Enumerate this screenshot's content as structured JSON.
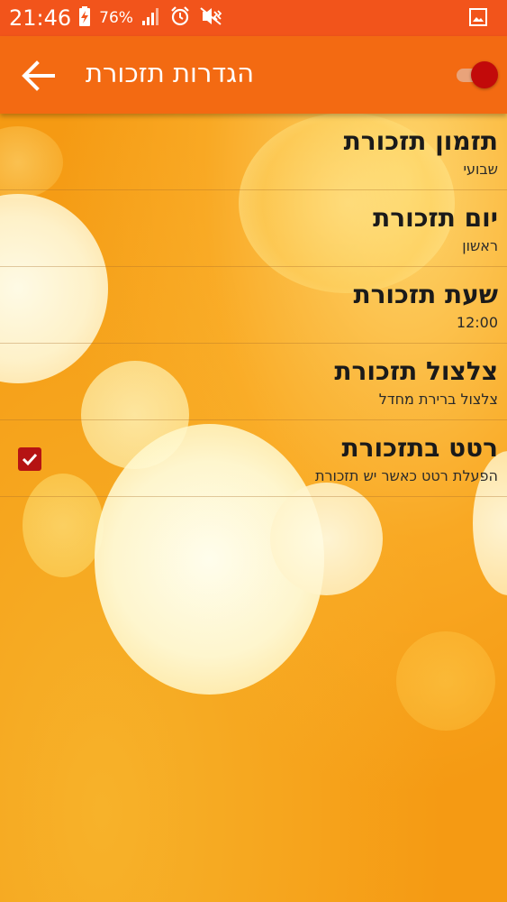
{
  "status_bar": {
    "time": "21:46",
    "battery_percent": "76%",
    "icons": [
      "charging-battery-icon",
      "signal-icon",
      "alarm-icon",
      "vibrate-mute-icon",
      "screenshot-icon"
    ]
  },
  "app_bar": {
    "title": "הגדרות תזכורת",
    "back_icon": "back-arrow-icon",
    "toggle_on": true
  },
  "settings": [
    {
      "title": "תזמון תזכורת",
      "summary": "שבועי"
    },
    {
      "title": "יום תזכורת",
      "summary": "ראשון"
    },
    {
      "title": "שעת תזכורת",
      "summary": "12:00"
    },
    {
      "title": "צלצול תזכורת",
      "summary": "צלצול ברירת מחדל"
    },
    {
      "title": "רטט בתזכורת",
      "summary": "הפעלת רטט כאשר יש תזכורת",
      "checked": true
    }
  ],
  "colors": {
    "status_bar": "#f2541b",
    "app_bar": "#f36a12",
    "accent": "#c20a0a",
    "background": "#f6a51a"
  }
}
